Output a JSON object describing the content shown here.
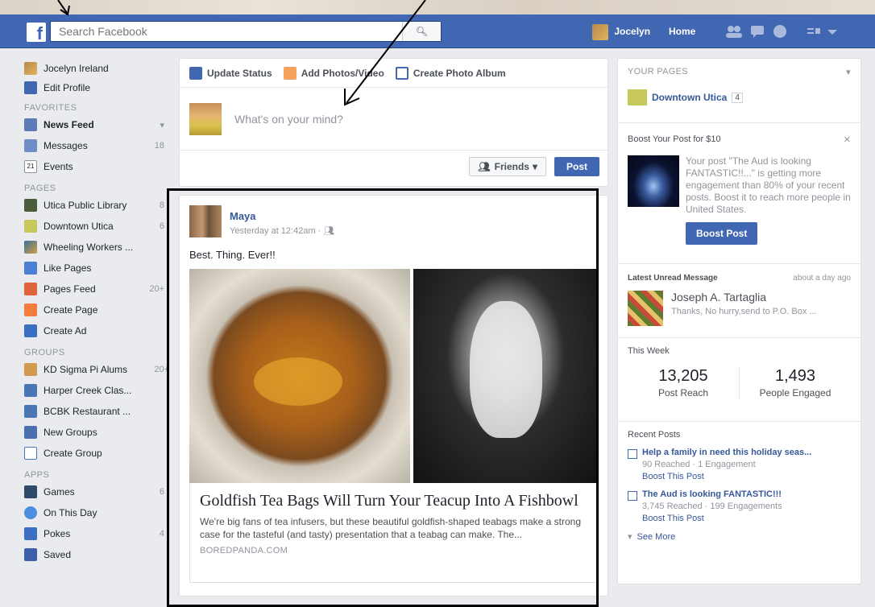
{
  "topbar": {
    "logo": "f",
    "search_placeholder": "Search Facebook",
    "user_name": "Jocelyn",
    "home_label": "Home"
  },
  "left_nav": {
    "profile_name": "Jocelyn Ireland",
    "edit_profile": "Edit Profile",
    "favorites_header": "FAVORITES",
    "favorites": [
      {
        "label": "News Feed",
        "count": ""
      },
      {
        "label": "Messages",
        "count": "18"
      },
      {
        "label": "Events",
        "count": ""
      }
    ],
    "pages_header": "PAGES",
    "pages": [
      {
        "label": "Utica Public Library",
        "count": "8"
      },
      {
        "label": "Downtown Utica",
        "count": "6"
      },
      {
        "label": "Wheeling Workers ...",
        "count": ""
      },
      {
        "label": "Like Pages",
        "count": ""
      },
      {
        "label": "Pages Feed",
        "count": "20+"
      },
      {
        "label": "Create Page",
        "count": ""
      },
      {
        "label": "Create Ad",
        "count": ""
      }
    ],
    "groups_header": "GROUPS",
    "groups": [
      {
        "label": "KD Sigma Pi Alums",
        "count": "20+"
      },
      {
        "label": "Harper Creek Clas...",
        "count": ""
      },
      {
        "label": "BCBK Restaurant ...",
        "count": ""
      },
      {
        "label": "New Groups",
        "count": ""
      },
      {
        "label": "Create Group",
        "count": ""
      }
    ],
    "apps_header": "APPS",
    "apps": [
      {
        "label": "Games",
        "count": "6"
      },
      {
        "label": "On This Day",
        "count": ""
      },
      {
        "label": "Pokes",
        "count": "4"
      },
      {
        "label": "Saved",
        "count": ""
      }
    ]
  },
  "composer": {
    "tab_status": "Update Status",
    "tab_photo": "Add Photos/Video",
    "tab_album": "Create Photo Album",
    "placeholder": "What's on your mind?",
    "audience": "Friends",
    "post_button": "Post"
  },
  "post": {
    "author": "Maya",
    "time": "Yesterday at 12:42am ·",
    "text": "Best. Thing. Ever!!",
    "link_title": "Goldfish Tea Bags Will Turn Your Teacup Into A Fishbowl",
    "link_desc": "We're big fans of tea infusers, but these beautiful goldfish-shaped teabags make a strong case for the tasteful (and tasty) presentation that a teabag can make. The...",
    "link_domain": "BOREDPANDA.COM"
  },
  "right": {
    "your_pages_header": "YOUR PAGES",
    "page_name": "Downtown Utica",
    "page_badge": "4",
    "boost_header": "Boost Your Post for $10",
    "boost_text": "Your post \"The Aud is looking FANTASTIC!!...\" is getting more engagement than 80% of your recent posts. Boost it to reach more people in United States.",
    "boost_button": "Boost Post",
    "msg_header": "Latest Unread Message",
    "msg_time": "about a day ago",
    "msg_sender": "Joseph A. Tartaglia",
    "msg_snippet": "Thanks, No hurry,send to P.O. Box ...",
    "week_header": "This Week",
    "reach_value": "13,205",
    "reach_label": "Post Reach",
    "engaged_value": "1,493",
    "engaged_label": "People Engaged",
    "recent_header": "Recent Posts",
    "recent": [
      {
        "title": "Help a family in need this holiday seas...",
        "meta": "90 Reached · 1 Engagement",
        "boost": "Boost This Post"
      },
      {
        "title": "The Aud is looking FANTASTIC!!!",
        "meta": "3,745 Reached · 199 Engagements",
        "boost": "Boost This Post"
      }
    ],
    "see_more": "See More"
  },
  "colors": {
    "brand_blue": "#4267b2",
    "link_blue": "#365899",
    "bg": "#e9ebee"
  }
}
